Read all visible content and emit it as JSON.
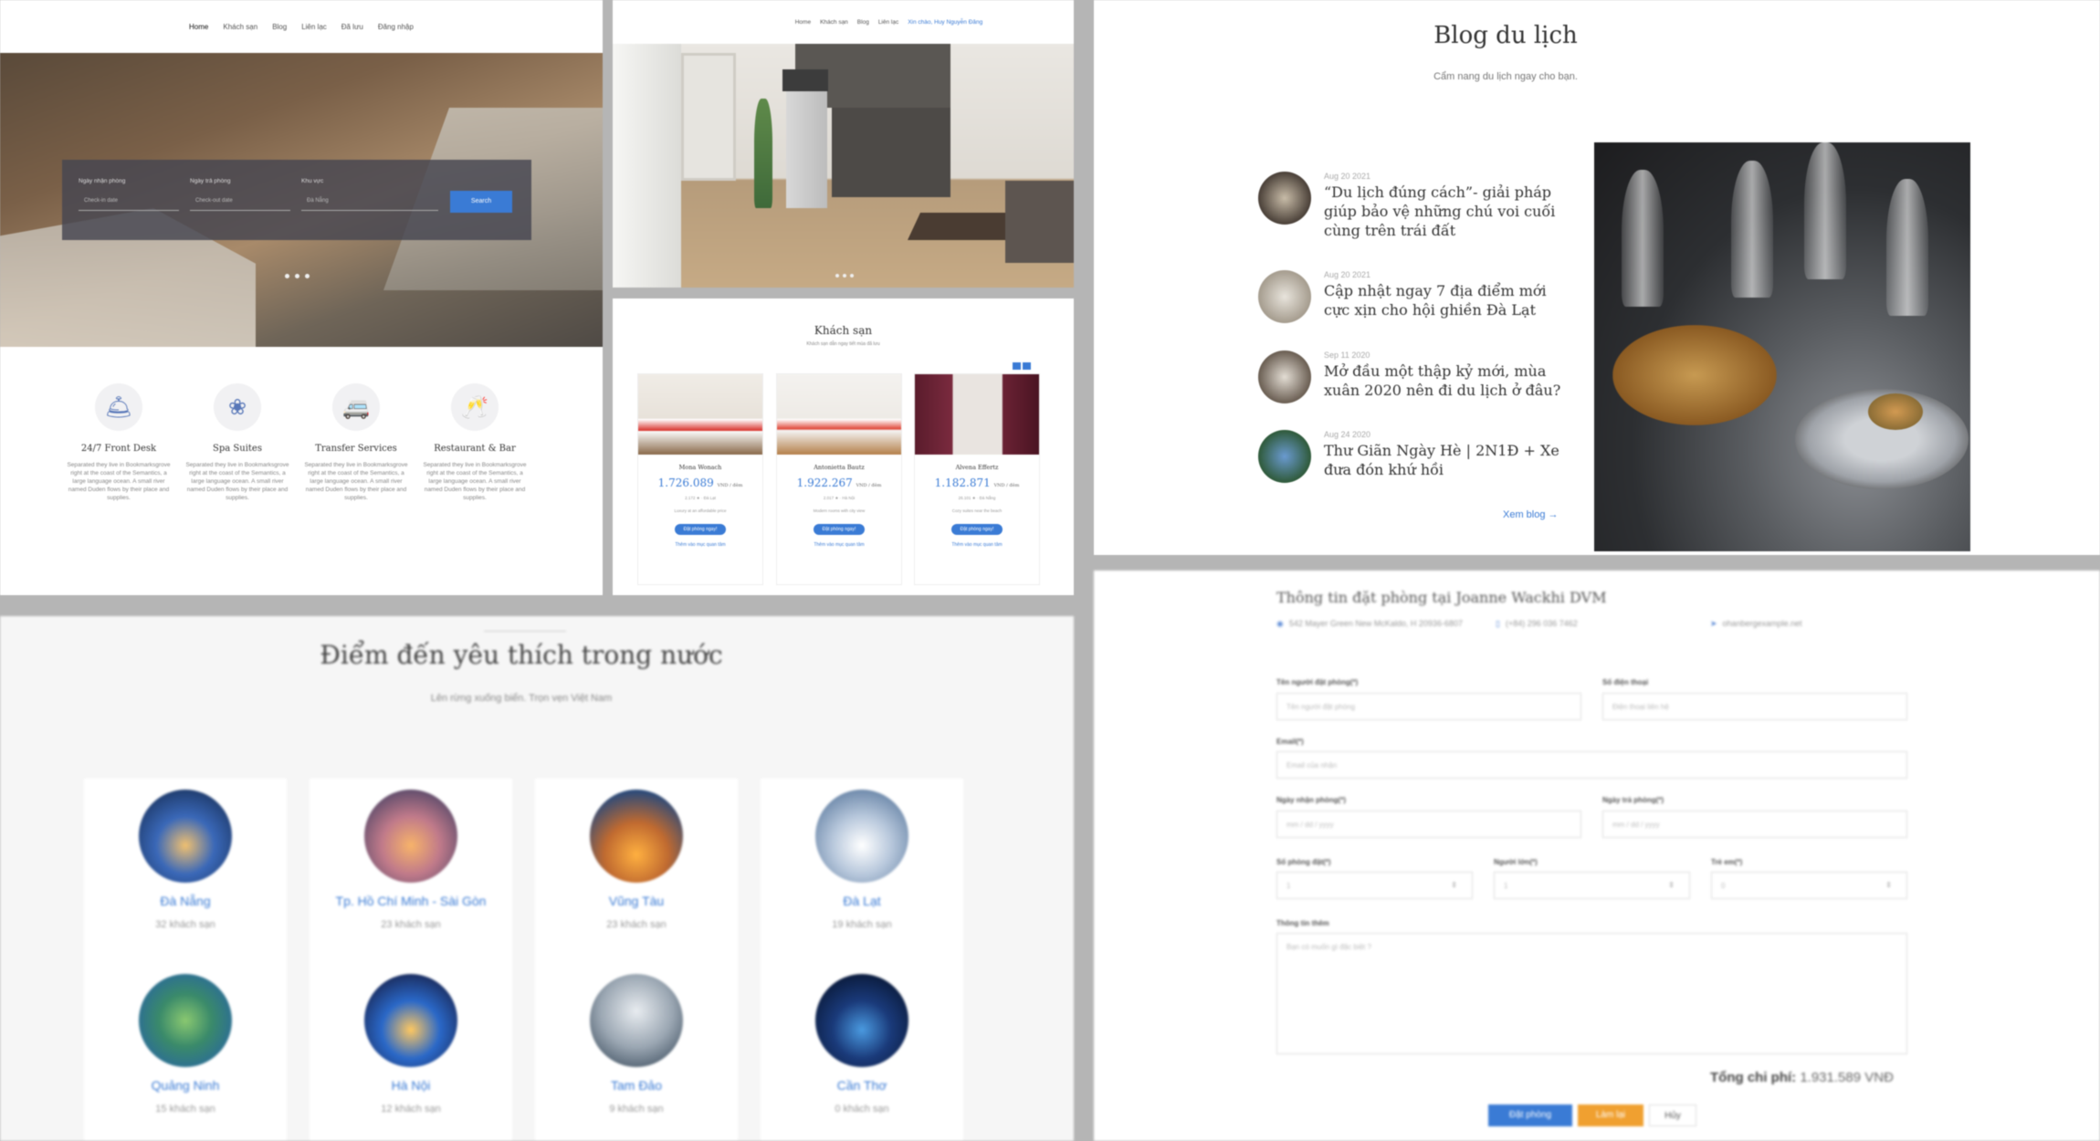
{
  "home": {
    "nav": [
      "Home",
      "Khách sạn",
      "Blog",
      "Liên lạc",
      "Đã lưu",
      "Đăng nhập"
    ],
    "search": {
      "checkin_label": "Ngày nhận phòng",
      "checkin_placeholder": "Check-in date",
      "checkout_label": "Ngày trả phòng",
      "checkout_placeholder": "Check-out date",
      "area_label": "Khu vực",
      "area_placeholder": "Đà Nẵng",
      "button": "Search"
    },
    "services": [
      {
        "title": "24/7 Front Desk",
        "icon": "front-desk-icon",
        "text": "Separated they live in Bookmarksgrove right at the coast of the Semantics, a large language ocean. A small river named Duden flows by their place and supplies."
      },
      {
        "title": "Spa Suites",
        "icon": "spa-icon",
        "text": "Separated they live in Bookmarksgrove right at the coast of the Semantics, a large language ocean. A small river named Duden flows by their place and supplies."
      },
      {
        "title": "Transfer Services",
        "icon": "car-icon",
        "text": "Separated they live in Bookmarksgrove right at the coast of the Semantics, a large language ocean. A small river named Duden flows by their place and supplies."
      },
      {
        "title": "Restaurant & Bar",
        "icon": "glasses-icon",
        "text": "Separated they live in Bookmarksgrove right at the coast of the Semantics, a large language ocean. A small river named Duden flows by their place and supplies."
      }
    ]
  },
  "room": {
    "nav": [
      "Home",
      "Khách sạn",
      "Blog",
      "Liên lạc",
      "Xin chào, Huy Nguyễn Đăng"
    ]
  },
  "hotels": {
    "title": "Khách sạn",
    "subtitle": "Khách sạn dẫn ngay tiết mùa đã lưu",
    "cards": [
      {
        "name": "Mona Wonach",
        "price": "1.726.089",
        "unit": "VND / đêm",
        "meta": "2.172 ★ · Đà Lạt",
        "desc": "Luxury at an affordable price",
        "book": "Đặt phòng ngay!",
        "link": "Thêm vào mục quan tâm"
      },
      {
        "name": "Antonietta Bautz",
        "price": "1.922.267",
        "unit": "VND / đêm",
        "meta": "2.017 ★ · Hà Nội",
        "desc": "Modern rooms with city view",
        "book": "Đặt phòng ngay!",
        "link": "Thêm vào mục quan tâm"
      },
      {
        "name": "Alvena Effertz",
        "price": "1.182.871",
        "unit": "VND / đêm",
        "meta": "26.101 ★ · Đà Nẵng",
        "desc": "Cozy suites near the beach",
        "book": "Đặt phòng ngay!",
        "link": "Thêm vào mục quan tâm"
      }
    ]
  },
  "blog": {
    "title": "Blog du lịch",
    "subtitle": "Cẩm nang du lịch ngay cho bạn.",
    "posts": [
      {
        "date": "Aug 20 2021",
        "title": "“Du lịch đúng cách”- giải pháp giúp bảo vệ những chú voi cuối cùng trên trái đất"
      },
      {
        "date": "Aug 20 2021",
        "title": "Cập nhật ngay 7 địa điểm mới cực xịn cho hội ghiền Đà Lạt"
      },
      {
        "date": "Sep 11 2020",
        "title": "Mở đầu một thập kỷ mới, mùa xuân 2020 nên đi du lịch ở đâu?"
      },
      {
        "date": "Aug 24 2020",
        "title": "Thư Giãn Ngày Hè | 2N1Đ + Xe đưa đón khứ hồi"
      }
    ],
    "more": "Xem blog →"
  },
  "destinations": {
    "title": "Điểm đến yêu thích trong nước",
    "subtitle": "Lên rừng xuống biển. Trọn vẹn Việt Nam",
    "items": [
      {
        "name": "Đà Nẵng",
        "count": "32 khách sạn"
      },
      {
        "name": "Tp. Hồ Chí Minh - Sài Gòn",
        "count": "23 khách sạn"
      },
      {
        "name": "Vũng Tàu",
        "count": "23 khách sạn"
      },
      {
        "name": "Đà Lạt",
        "count": "19 khách sạn"
      },
      {
        "name": "Quảng Ninh",
        "count": "15 khách sạn"
      },
      {
        "name": "Hà Nội",
        "count": "12 khách sạn"
      },
      {
        "name": "Tam Đảo",
        "count": "9 khách sạn"
      },
      {
        "name": "Cần Thơ",
        "count": "0 khách sạn"
      }
    ]
  },
  "booking": {
    "title": "Thông tin đặt phòng tại Joanne Wackhi DVM",
    "address": "542 Mayer Green New McKaldo, H 20936-6807",
    "phone": "(+84) 296 036 7462",
    "email": "ohanbergexample.net",
    "name_label": "Tên người đặt phòng(*)",
    "name_placeholder": "Tên người đặt phòng",
    "phone_label": "Số điện thoại",
    "phone_placeholder": "Điện thoại liên hệ",
    "email_label": "Email(*)",
    "email_placeholder": "Email của nhận",
    "checkin_label": "Ngày nhận phòng(*)",
    "checkin_placeholder": "mm / dd / yyyy",
    "checkout_label": "Ngày trả phòng(*)",
    "checkout_placeholder": "mm / dd / yyyy",
    "rooms_label": "Số phòng đặt(*)",
    "rooms_value": "1",
    "adults_label": "Người lớn(*)",
    "adults_value": "1",
    "kids_label": "Trẻ em(*)",
    "kids_value": "0",
    "note_label": "Thông tin thêm",
    "note_placeholder": "Bạn có muốn gì đặc biệt ?",
    "total_label": "Tổng chi phí:",
    "total_value": "1.931.589 VNĐ",
    "submit": "Đặt phòng",
    "reset": "Làm lại",
    "cancel": "Hủy"
  }
}
